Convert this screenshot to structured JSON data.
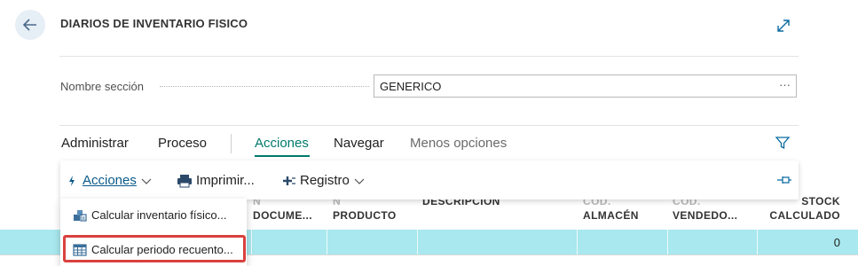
{
  "header": {
    "title": "DIARIOS DE INVENTARIO FISICO"
  },
  "field": {
    "label": "Nombre sección",
    "value": "GENERICO",
    "ellipsis": "···"
  },
  "menu": {
    "items": [
      "Administrar",
      "Proceso",
      "Acciones",
      "Navegar",
      "Menos opciones"
    ],
    "active": "Acciones"
  },
  "toolbar": {
    "acciones": "Acciones",
    "imprimir": "Imprimir...",
    "registro": "Registro"
  },
  "dropdown": {
    "items": [
      "Calcular inventario físico...",
      "Calcular periodo recuento..."
    ],
    "selected_index": 1
  },
  "table": {
    "columns": [
      {
        "line1": "N",
        "line2": "DOCUME..."
      },
      {
        "line1": "N",
        "line2": "PRODUCTO"
      },
      {
        "line1": "",
        "line2": "DESCRIPCIÓN"
      },
      {
        "line1": "COD.",
        "line2": "ALMACÉN"
      },
      {
        "line1": "COD.",
        "line2": "VENDEDO..."
      },
      {
        "line1": "STOCK",
        "line2": "CALCULADO"
      }
    ],
    "rows": [
      {
        "stock_calculado": "0"
      }
    ]
  },
  "colors": {
    "accent": "#00796b",
    "link": "#0a5a8a",
    "row_highlight": "#a8e8ee",
    "selection_border": "#d9413e"
  }
}
